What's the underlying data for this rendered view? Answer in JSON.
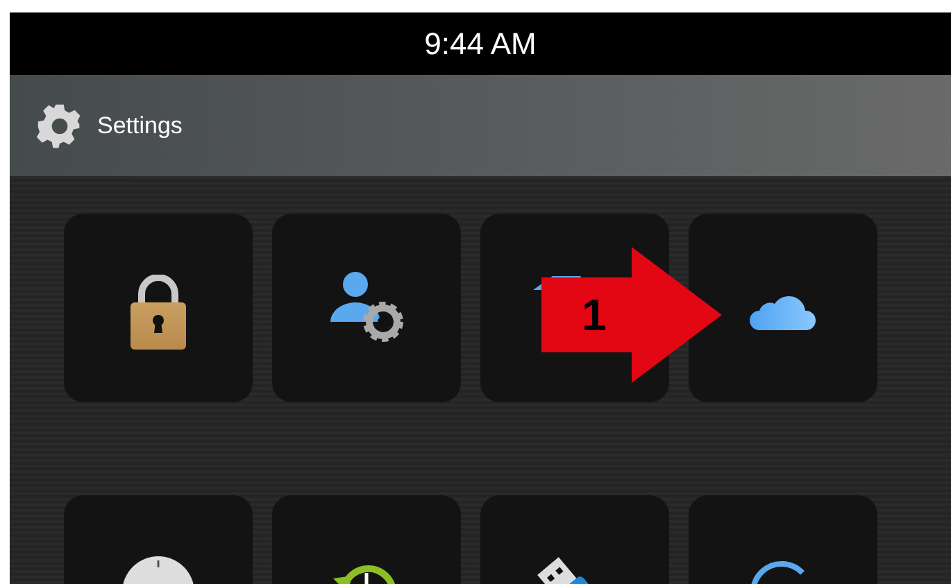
{
  "status_bar": {
    "time": "9:44 AM"
  },
  "header": {
    "title": "Settings"
  },
  "tiles": [
    {
      "kind": "lock"
    },
    {
      "kind": "user-gear"
    },
    {
      "kind": "shape"
    },
    {
      "kind": "cloud"
    },
    {
      "kind": "clock"
    },
    {
      "kind": "restore"
    },
    {
      "kind": "usb"
    },
    {
      "kind": "refresh"
    }
  ],
  "annotation": {
    "label": "1"
  }
}
